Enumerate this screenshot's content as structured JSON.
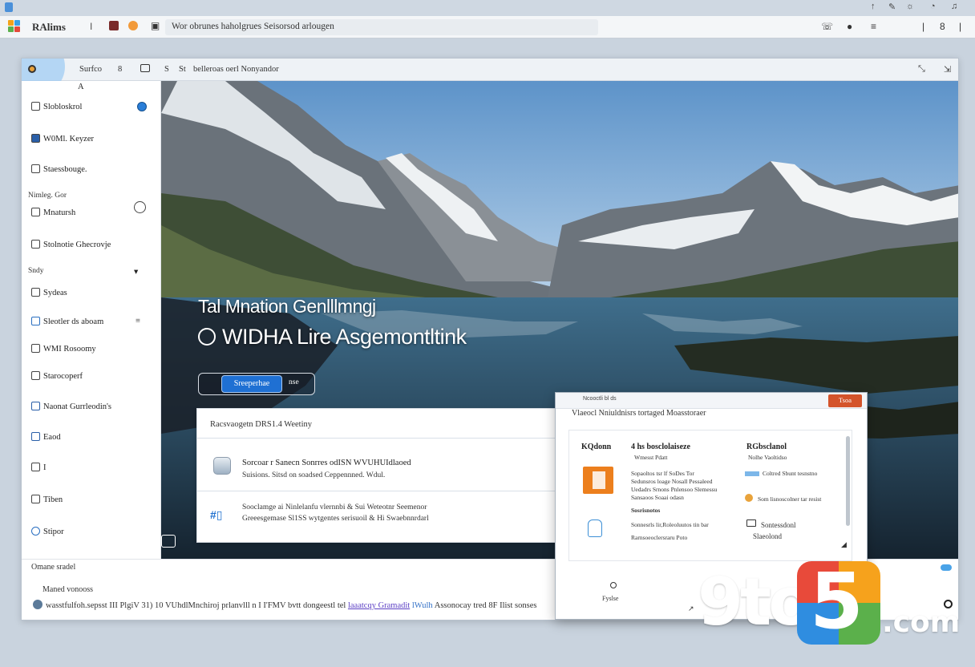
{
  "os_bar": {
    "icons": [
      "arrow-up-icon",
      "cursor-icon",
      "sun-icon",
      "wifi-icon",
      "bell-icon"
    ]
  },
  "browser": {
    "title": "RAlims",
    "separator": "I",
    "address": "Wor obrunes haholgrues Seisorsod arlougen",
    "controls": [
      "phone-icon",
      "record-icon",
      "menu-icon",
      "close-icon"
    ]
  },
  "window": {
    "header": {
      "crumb1": "Surfco",
      "crumb2": "8",
      "crumb3": "S",
      "crumb4": "St",
      "path": "belleroas oerl Nonyandor"
    },
    "sidebar": {
      "items": [
        "Slobloskrol",
        "W0Ml. Keyzer",
        "Staessbouge.",
        "Mnatursh",
        "Stolnotie Ghecrovje",
        "Sydeas",
        "Sleotler ds aboam",
        "WMI Rosoomy",
        "Starocoperf",
        "Naonat Gurrleodin's",
        "Eaod",
        "I",
        "Tiben",
        "Stipor"
      ],
      "sections": [
        "Nimleg. Gor",
        "Sndy"
      ],
      "top_small": "A"
    },
    "hero": {
      "title1": "Tal Mnation Genlllmngj",
      "title2": "WIDHA Lire Asgemontltink",
      "primary_button": "Sreeperhae",
      "secondary_button": "nse"
    },
    "card": {
      "header": "Racsvaogetn DRS1.4 Weetiny",
      "row1_title": "Sorcoar r Sanecn Sonrres odISN WVUHUIdlaoed",
      "row1_sub": "Suisions. Sitsd on soadsed Ceppennned. Wdul.",
      "row2_line1": "Sooclamge ai Ninlelanfu vlernnbi & Sui Weteotnr Seemenor",
      "row2_line2": "Greeesgemase Sl1SS wytgentes serisuoil & Hi Swaebnnrdarl"
    },
    "bottom": {
      "line1": "Omane sradel",
      "line2": "Maned vonooss",
      "line3_pre": "wasstfulfoh.sepsst III PlgiV 31) 10 VUhdlMnchiroj prlanvlll n I I'FMV bvtt dongeestl tel",
      "line3_link1": "laaatcqy Gramadit",
      "line3_link2": "lWulh",
      "line3_post": "Assonocay tred 8F Ilist sonses"
    }
  },
  "dialog": {
    "top_title": "Ncooctli bl ds",
    "top_button": "Tsoa",
    "subtitle": "Vlaeocl Nniuldnisrs tortaged Moasstoraer",
    "col1_head": "KQdonn",
    "col2_head": "4 hs bosclolaiseze",
    "col2_sub": "Wmesst Pdatt",
    "col3_head": "RGbsclanol",
    "col3_sub": "Nolhe Vaoltidso",
    "col2_lines": [
      "Sopaoltos tsr lf SoDes Tor",
      "Sedunsros loage Nosall Pessaleed",
      "Uedadrs Srnons Pnlensoo Slemessu",
      "Sansaoos Soaai odasn"
    ],
    "col2_head2": "Sosrisnotos",
    "col2_lines2": [
      "Sonnesrls lir,Roleoluutos tin bar",
      "Rarnsoeoclersraru Poto"
    ],
    "col3_line1": "Coltred Sbunt tesnstno",
    "col3_line2": "Som lisnoscolner tar resist",
    "col3_line3": "Sontessdonl",
    "col3_line4": "Slaeolond",
    "footer": "Fyslse"
  },
  "watermark": {
    "left": "9to",
    "digit": "5",
    "suffix": ".com"
  },
  "colors": {
    "accent": "#1f70d3",
    "dialog_button": "#d4542b",
    "office": "#ec7f1d"
  }
}
